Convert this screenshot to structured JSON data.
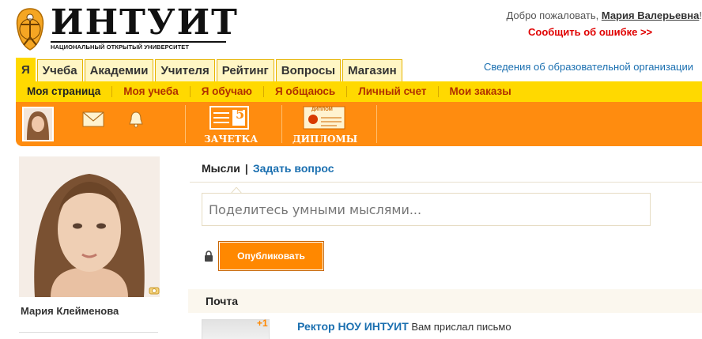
{
  "header": {
    "logo_name": "ИНТУИТ",
    "logo_subtitle": "НАЦИОНАЛЬНЫЙ ОТКРЫТЫЙ УНИВЕРСИТЕТ",
    "welcome_prefix": "Добро пожаловать, ",
    "user_full_name": "Мария Валерьевна",
    "welcome_suffix": "!",
    "report_error": "Сообщить об ошибке >>"
  },
  "tabs": [
    {
      "label": "Я",
      "active": true
    },
    {
      "label": "Учеба"
    },
    {
      "label": "Академии"
    },
    {
      "label": "Учителя"
    },
    {
      "label": "Рейтинг"
    },
    {
      "label": "Вопросы"
    },
    {
      "label": "Магазин"
    }
  ],
  "edu_link": "Сведения об образовательной организации",
  "subnav": [
    "Моя страница",
    "Моя учеба",
    "Я обучаю",
    "Я общаюсь",
    "Личный счет",
    "Мои заказы"
  ],
  "orange_bar": {
    "gradebook_label": "ЗАЧЕТКА",
    "gradebook_number": "5",
    "diplomas_label": "ДИПЛОМЫ",
    "diploma_mini": "ДИПЛОМ"
  },
  "profile": {
    "name": "Мария Клейменова"
  },
  "thoughts": {
    "tab_current": "Мысли",
    "separator": "|",
    "tab_ask": "Задать вопрос",
    "placeholder": "Поделитесь умными мыслями...",
    "publish": "Опубликовать"
  },
  "mail": {
    "title": "Почта",
    "badge": "+1",
    "sender": "Ректор НОУ ИНТУИТ",
    "text": " Вам прислал письмо"
  },
  "colors": {
    "brand_orange": "#ff8c0f",
    "brand_yellow": "#ffd900",
    "link_blue": "#1a6fb0",
    "error_red": "#e00000"
  }
}
